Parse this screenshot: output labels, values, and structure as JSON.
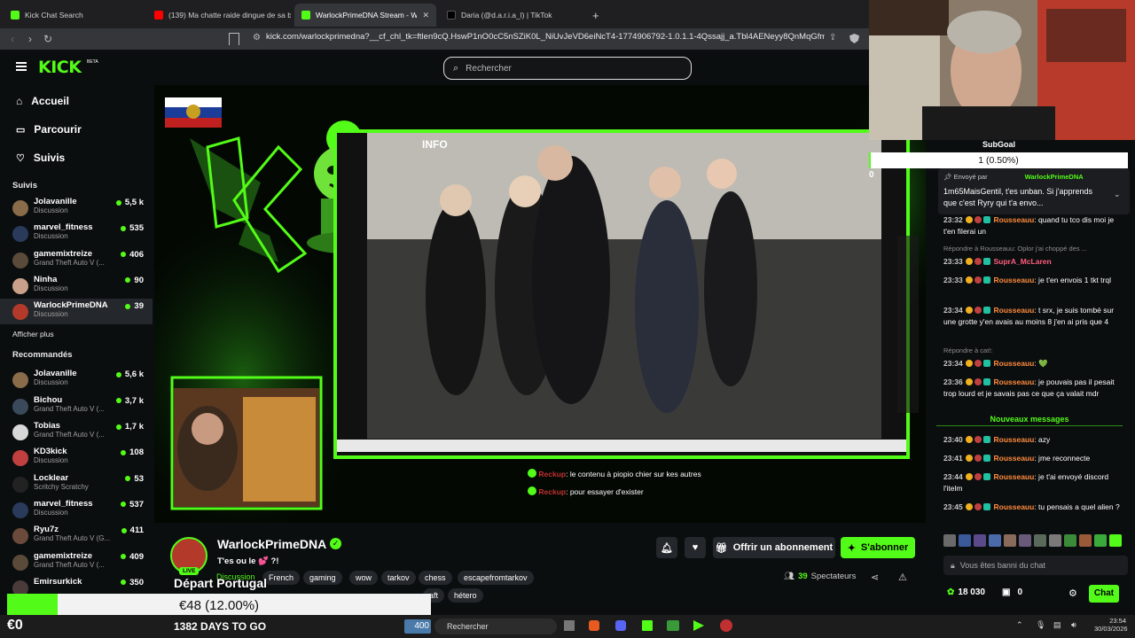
{
  "tabs": [
    {
      "title": "Kick Chat Search",
      "color": "#53fc18"
    },
    {
      "title": "(139) Ma chatte raide dingue de sa b",
      "color": "#ff0000"
    },
    {
      "title": "WarlockPrimeDNA Stream - Wat",
      "color": "#53fc18"
    },
    {
      "title": "Daria (@d.a.r.i.a_l) | TikTok",
      "color": "#000000"
    }
  ],
  "tab_close": "✕",
  "new_tab": "+",
  "url": "kick.com/warlockprimedna?__cf_chl_tk=ftlen9cQ.HswP1nO0cC5nSZiK0L_NiUvJeVD6eiNcT4-1774906792-1.0.1.1-4Qssajj_a.Tbl4AENeyy8QnMqGfm4go...",
  "kick": {
    "logo": "KICK",
    "beta": "BETA",
    "search_placeholder": "Rechercher"
  },
  "sidebar": {
    "nav": [
      {
        "label": "Accueil",
        "icon": "home-icon"
      },
      {
        "label": "Parcourir",
        "icon": "browse-icon"
      },
      {
        "label": "Suivis",
        "icon": "heart-icon"
      }
    ],
    "following_title": "Suivis",
    "following": [
      {
        "name": "Jolavanille",
        "category": "Discussion",
        "viewers": "5,5 k",
        "color": "#8a6b4a"
      },
      {
        "name": "marvel_fitness",
        "category": "Discussion",
        "viewers": "535",
        "color": "#2a3a5a"
      },
      {
        "name": "gamemixtreize",
        "category": "Grand Theft Auto V (...",
        "viewers": "406",
        "color": "#5a4a3a"
      },
      {
        "name": "Ninha",
        "category": "Discussion",
        "viewers": "90",
        "color": "#c9a08a"
      },
      {
        "name": "WarlockPrimeDNA",
        "category": "Discussion",
        "viewers": "39",
        "color": "#b33a2a"
      }
    ],
    "show_more": "Afficher plus",
    "recommended_title": "Recommandés",
    "recommended": [
      {
        "name": "Jolavanille",
        "category": "Discussion",
        "viewers": "5,6 k",
        "color": "#8a6b4a"
      },
      {
        "name": "Bichou",
        "category": "Grand Theft Auto V (...",
        "viewers": "3,7 k",
        "color": "#3a4a5a"
      },
      {
        "name": "Tobias",
        "category": "Grand Theft Auto V (...",
        "viewers": "1,7 k",
        "color": "#d8d8d8"
      },
      {
        "name": "KD3kick",
        "category": "Discussion",
        "viewers": "108",
        "color": "#c04040"
      },
      {
        "name": "Locklear",
        "category": "Scritchy Scratchy",
        "viewers": "53",
        "color": "#222"
      },
      {
        "name": "marvel_fitness",
        "category": "Discussion",
        "viewers": "537",
        "color": "#2a3a5a"
      },
      {
        "name": "Ryu7z",
        "category": "Grand Theft Auto V (G...",
        "viewers": "411",
        "color": "#6a4a3a"
      },
      {
        "name": "gamemixtreize",
        "category": "Grand Theft Auto V (...",
        "viewers": "409",
        "color": "#5a4a3a"
      },
      {
        "name": "Emirsurkick",
        "category": "",
        "viewers": "350",
        "color": "#4a3a3a"
      }
    ]
  },
  "video": {
    "info_label": "INFO",
    "overlay_msgs": [
      {
        "user": "Reckup",
        "text": ": le contenu à piopio chier sur kes autres"
      },
      {
        "user": "Reckup",
        "text": ": pour essayer d'exister"
      }
    ]
  },
  "stream": {
    "name": "WarlockPrimeDNA",
    "title": "T'es ou le 💕 ?!",
    "category": "Discussion",
    "tags": [
      "French",
      "gaming",
      "wow",
      "tarkov",
      "chess",
      "escapefromtarkov",
      "hétero"
    ],
    "tag_partial": "aft",
    "live": "LIVE",
    "subscribe_gift": "Offrir un abonnement",
    "subscribe": "S'abonner",
    "viewers_count": "39",
    "viewers_label": "Spectateurs"
  },
  "overlay": {
    "depart": "Départ Portugal",
    "progress_amount": "€48 (12.00%)",
    "progress_pct": 12,
    "euro_zero": "€0",
    "days": "1382 DAYS TO GO",
    "subgoal_label": "SubGoal",
    "subgoal_value": "1 (0.50%)",
    "subgoal_zero": "0"
  },
  "pinned": {
    "sender_label": "Envoyé par",
    "sender": "WarlockPrimeDNA",
    "text": "1m65MaisGentil, t'es unban. Si j'apprends que c'est Ryry qui t'a envo..."
  },
  "chat": {
    "messages": [
      {
        "time": "23:32",
        "user": "Rousseauu",
        "text": ": quand tu tco dis moi je t'en filerai un"
      },
      {
        "reply": "Répondre à Rousseauu: Oplor j'ai choppé des ..."
      },
      {
        "time": "23:33",
        "user": "SuprA_McLaren",
        "text": ""
      },
      {
        "time": "23:33",
        "user": "Rousseauu",
        "text": ": je t'en envois 1 tkt trql"
      },
      {
        "time": "23:34",
        "user": "Rousseauu",
        "text": ": t srx, je suis tombé sur une grotte y'en avais au moins 8 j'en ai pris que 4"
      },
      {
        "reply": "Répondre à cat!:"
      },
      {
        "time": "23:34",
        "user": "Rousseauu",
        "text": ": 💚"
      },
      {
        "time": "23:36",
        "user": "Rousseauu",
        "text": ": je pouvais pas il pesait trop lourd et je savais pas ce que ça valait mdr"
      }
    ],
    "new_messages": "Nouveaux messages",
    "new": [
      {
        "time": "23:40",
        "user": "Rousseauu",
        "text": ": azy"
      },
      {
        "time": "23:41",
        "user": "Rousseauu",
        "text": ": jme reconnecte"
      },
      {
        "time": "23:44",
        "user": "Rousseauu",
        "text": ": je t'ai envoyé discord l'itelm"
      },
      {
        "time": "23:45",
        "user": "Rousseauu",
        "text": ": tu pensais a quel alien ?"
      }
    ],
    "banned": "Vous êtes banni du chat",
    "points": "18 030",
    "zero": "0",
    "chat_button": "Chat"
  },
  "taskbar": {
    "weather": "400",
    "search": "Rechercher",
    "time": "23:54",
    "date": "30/03/2026"
  },
  "colors": {
    "kick_green": "#53fc18",
    "username_orange": "#ff8b3d"
  }
}
